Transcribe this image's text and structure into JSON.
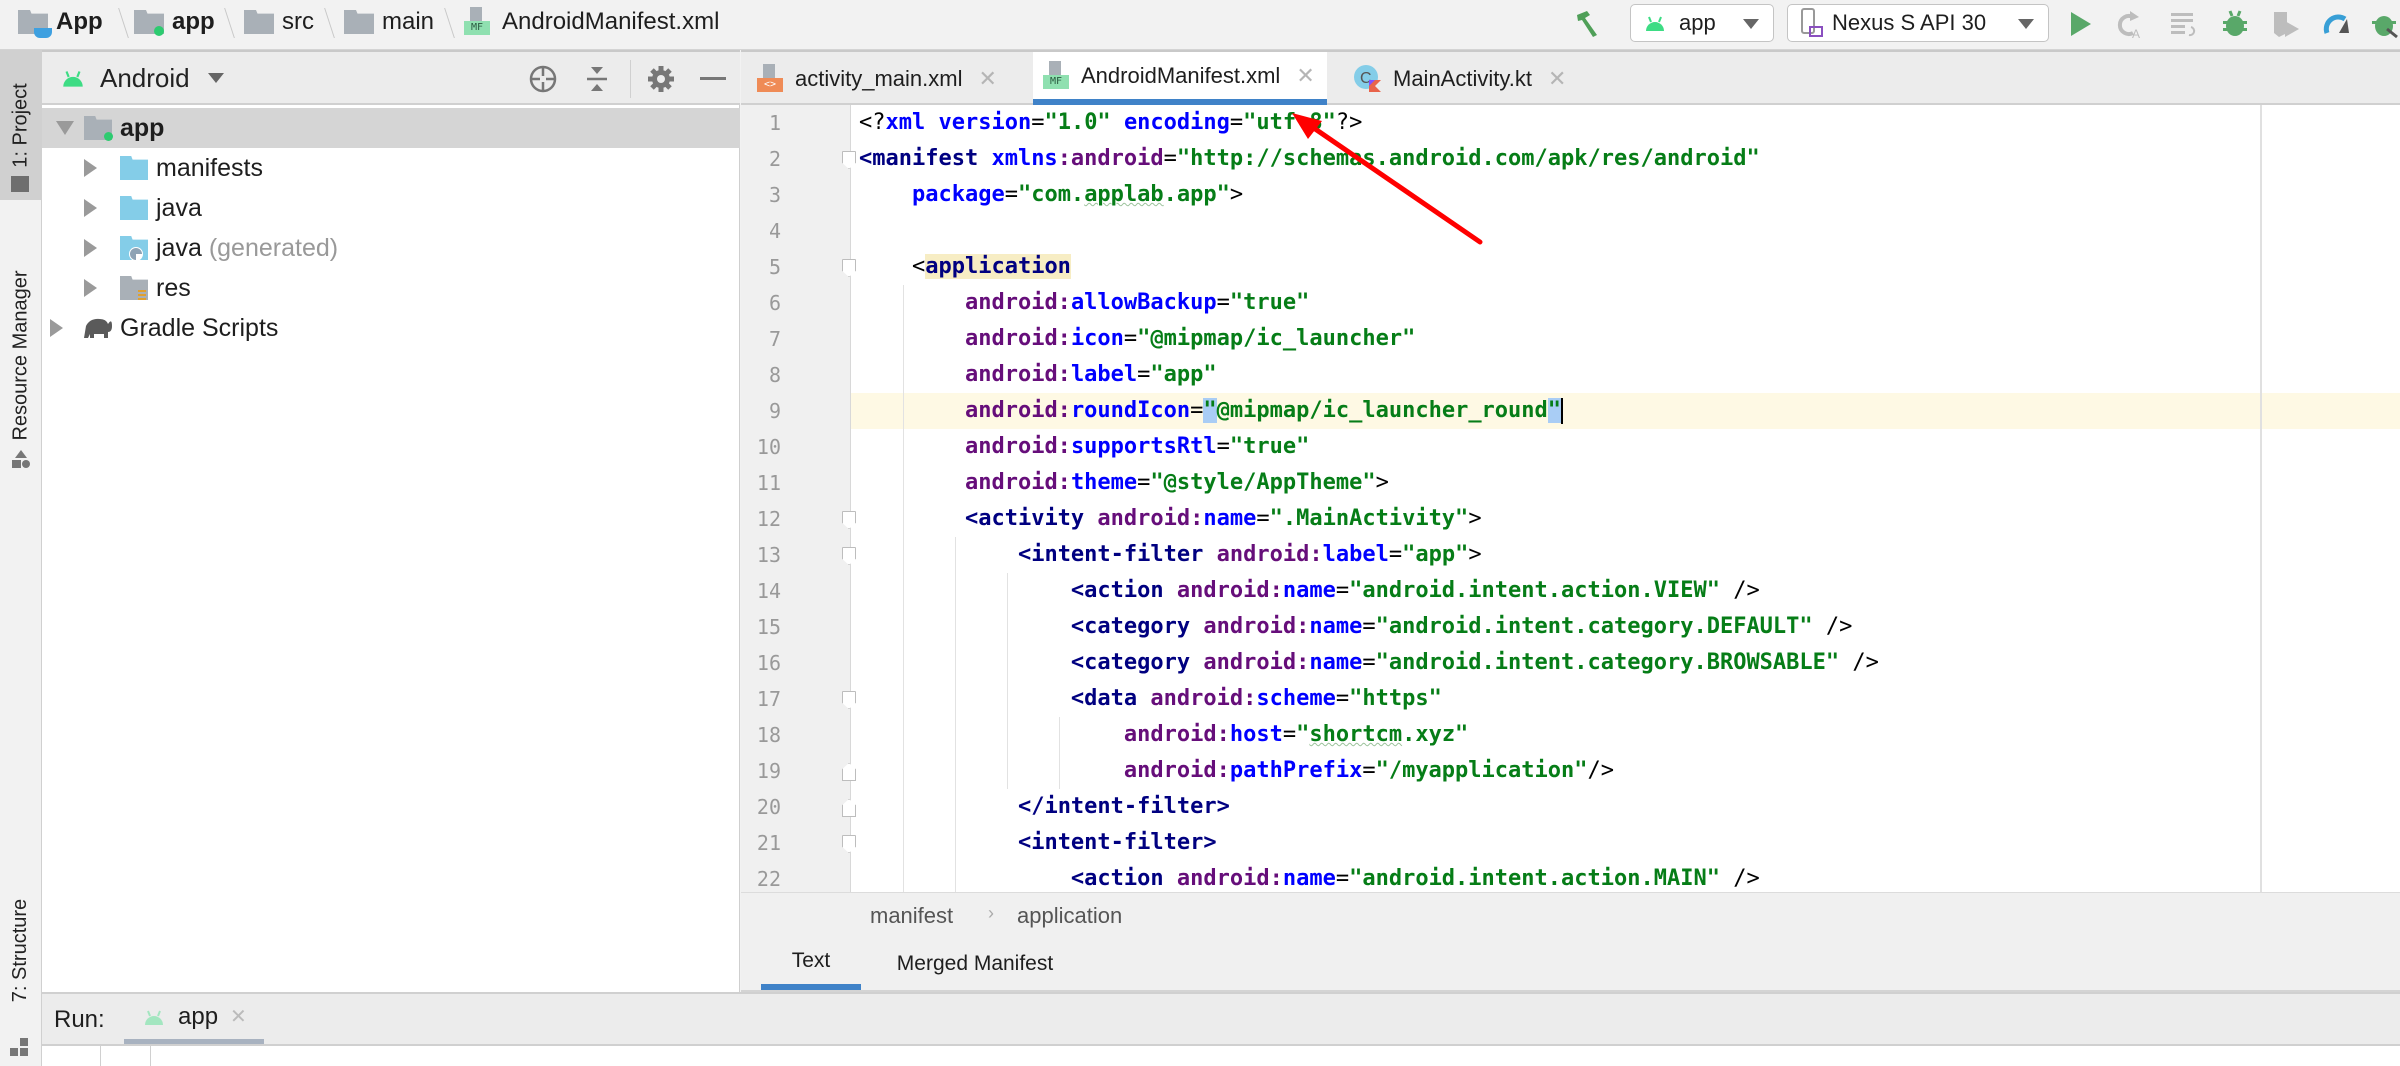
{
  "navbar": {
    "breadcrumb": [
      {
        "label": "App",
        "icon": "project-folder-icon"
      },
      {
        "label": "app",
        "icon": "module-folder-icon"
      },
      {
        "label": "src",
        "icon": "folder-icon"
      },
      {
        "label": "main",
        "icon": "folder-icon"
      },
      {
        "label": "AndroidManifest.xml",
        "icon": "manifest-file-icon"
      }
    ],
    "run_config": "app",
    "device": "Nexus S API 30",
    "toolbar_icons": [
      "build-hammer-icon",
      "run-icon",
      "apply-changes-icon",
      "apply-code-changes-icon",
      "debug-icon",
      "run-with-coverage-icon",
      "profile-icon",
      "attach-debugger-icon"
    ]
  },
  "left_stripe": {
    "tabs": [
      {
        "label": "1: Project",
        "active": true
      },
      {
        "label": "Resource Manager",
        "active": false
      },
      {
        "label": "7: Structure",
        "active": false
      }
    ]
  },
  "project_panel": {
    "view_selector": "Android",
    "header_icons": [
      "locate-icon",
      "collapse-all-icon",
      "settings-gear-icon",
      "hide-panel-icon"
    ],
    "tree": [
      {
        "label": "app",
        "level": 0,
        "expanded": true,
        "selected": true,
        "bold": true
      },
      {
        "label": "manifests",
        "level": 1,
        "expanded": false
      },
      {
        "label": "java",
        "level": 1,
        "expanded": false
      },
      {
        "label": "java",
        "suffix": "(generated)",
        "level": 1,
        "expanded": false
      },
      {
        "label": "res",
        "level": 1,
        "expanded": false
      },
      {
        "label": "Gradle Scripts",
        "level": 0,
        "expanded": false
      }
    ]
  },
  "editor_tabs": [
    {
      "label": "activity_main.xml",
      "active": false,
      "badge": "<>"
    },
    {
      "label": "AndroidManifest.xml",
      "active": true,
      "badge": "MF"
    },
    {
      "label": "MainActivity.kt",
      "active": false,
      "badge": "K"
    }
  ],
  "editor": {
    "current_line": 9,
    "lines": [
      {
        "n": "1",
        "tokens": [
          [
            "p",
            "<?"
          ],
          [
            "attr",
            "xml "
          ],
          [
            "attr",
            "version"
          ],
          [
            "p",
            "="
          ],
          [
            "val",
            "\"1.0\" "
          ],
          [
            "attr",
            "encoding"
          ],
          [
            "p",
            "="
          ],
          [
            "val",
            "\"utf-8\""
          ],
          [
            "p",
            "?>"
          ]
        ]
      },
      {
        "n": "2",
        "tokens": [
          [
            "tag",
            "<manifest "
          ],
          [
            "attr",
            "xmlns"
          ],
          [
            "ns",
            ":android"
          ],
          [
            "p",
            "="
          ],
          [
            "val",
            "\"http://schemas.android.com/apk/res/android\""
          ]
        ]
      },
      {
        "n": "3",
        "tokens": [
          [
            "ind",
            "    "
          ],
          [
            "attr",
            "package"
          ],
          [
            "p",
            "="
          ],
          [
            "val",
            "\"com.applab.app\""
          ],
          [
            "p",
            ">"
          ]
        ]
      },
      {
        "n": "4",
        "tokens": []
      },
      {
        "n": "5",
        "tokens": [
          [
            "ind",
            "    "
          ],
          [
            "p",
            "<"
          ],
          [
            "tagh",
            "application"
          ]
        ]
      },
      {
        "n": "6",
        "tokens": [
          [
            "ind",
            "        "
          ],
          [
            "ns",
            "android:"
          ],
          [
            "attr",
            "allowBackup"
          ],
          [
            "p",
            "="
          ],
          [
            "val",
            "\"true\""
          ]
        ]
      },
      {
        "n": "7",
        "tokens": [
          [
            "ind",
            "        "
          ],
          [
            "ns",
            "android:"
          ],
          [
            "attr",
            "icon"
          ],
          [
            "p",
            "="
          ],
          [
            "val",
            "\"@mipmap/ic_launcher\""
          ]
        ]
      },
      {
        "n": "8",
        "tokens": [
          [
            "ind",
            "        "
          ],
          [
            "ns",
            "android:"
          ],
          [
            "attr",
            "label"
          ],
          [
            "p",
            "="
          ],
          [
            "val",
            "\"app\""
          ]
        ]
      },
      {
        "n": "9",
        "tokens": [
          [
            "ind",
            "        "
          ],
          [
            "ns",
            "android:"
          ],
          [
            "attr",
            "roundIcon"
          ],
          [
            "p",
            "="
          ],
          [
            "valm",
            "\""
          ],
          [
            "val",
            "@mipmap/ic_launcher_round"
          ],
          [
            "valm",
            "\""
          ]
        ]
      },
      {
        "n": "10",
        "tokens": [
          [
            "ind",
            "        "
          ],
          [
            "ns",
            "android:"
          ],
          [
            "attr",
            "supportsRtl"
          ],
          [
            "p",
            "="
          ],
          [
            "val",
            "\"true\""
          ]
        ]
      },
      {
        "n": "11",
        "tokens": [
          [
            "ind",
            "        "
          ],
          [
            "ns",
            "android:"
          ],
          [
            "attr",
            "theme"
          ],
          [
            "p",
            "="
          ],
          [
            "val",
            "\"@style/AppTheme\""
          ],
          [
            "p",
            ">"
          ]
        ]
      },
      {
        "n": "12",
        "tokens": [
          [
            "ind",
            "        "
          ],
          [
            "tag",
            "<activity "
          ],
          [
            "ns",
            "android:"
          ],
          [
            "attr",
            "name"
          ],
          [
            "p",
            "="
          ],
          [
            "val",
            "\".MainActivity\""
          ],
          [
            "p",
            ">"
          ]
        ]
      },
      {
        "n": "13",
        "tokens": [
          [
            "ind",
            "            "
          ],
          [
            "tag",
            "<intent-filter "
          ],
          [
            "ns",
            "android:"
          ],
          [
            "attr",
            "label"
          ],
          [
            "p",
            "="
          ],
          [
            "val",
            "\"app\""
          ],
          [
            "p",
            ">"
          ]
        ]
      },
      {
        "n": "14",
        "tokens": [
          [
            "ind",
            "                "
          ],
          [
            "tag",
            "<action "
          ],
          [
            "ns",
            "android:"
          ],
          [
            "attr",
            "name"
          ],
          [
            "p",
            "="
          ],
          [
            "val",
            "\"android.intent.action.VIEW\" "
          ],
          [
            "p",
            "/>"
          ]
        ]
      },
      {
        "n": "15",
        "tokens": [
          [
            "ind",
            "                "
          ],
          [
            "tag",
            "<category "
          ],
          [
            "ns",
            "android:"
          ],
          [
            "attr",
            "name"
          ],
          [
            "p",
            "="
          ],
          [
            "val",
            "\"android.intent.category.DEFAULT\" "
          ],
          [
            "p",
            "/>"
          ]
        ]
      },
      {
        "n": "16",
        "tokens": [
          [
            "ind",
            "                "
          ],
          [
            "tag",
            "<category "
          ],
          [
            "ns",
            "android:"
          ],
          [
            "attr",
            "name"
          ],
          [
            "p",
            "="
          ],
          [
            "val",
            "\"android.intent.category.BROWSABLE\" "
          ],
          [
            "p",
            "/>"
          ]
        ]
      },
      {
        "n": "17",
        "tokens": [
          [
            "ind",
            "                "
          ],
          [
            "tag",
            "<data "
          ],
          [
            "ns",
            "android:"
          ],
          [
            "attr",
            "scheme"
          ],
          [
            "p",
            "="
          ],
          [
            "val",
            "\"https\""
          ]
        ]
      },
      {
        "n": "18",
        "tokens": [
          [
            "ind",
            "                    "
          ],
          [
            "ns",
            "android:"
          ],
          [
            "attr",
            "host"
          ],
          [
            "p",
            "="
          ],
          [
            "val",
            "\""
          ],
          [
            "valsq",
            "shortcm"
          ],
          [
            "val",
            ".xyz\""
          ]
        ]
      },
      {
        "n": "19",
        "tokens": [
          [
            "ind",
            "                    "
          ],
          [
            "ns",
            "android:"
          ],
          [
            "attr",
            "pathPrefix"
          ],
          [
            "p",
            "="
          ],
          [
            "val",
            "\"/myapplication\""
          ],
          [
            "p",
            "/>"
          ]
        ]
      },
      {
        "n": "20",
        "tokens": [
          [
            "ind",
            "            "
          ],
          [
            "tag",
            "</intent-filter>"
          ]
        ]
      },
      {
        "n": "21",
        "tokens": [
          [
            "ind",
            "            "
          ],
          [
            "tag",
            "<intent-filter>"
          ]
        ]
      },
      {
        "n": "22",
        "tokens": [
          [
            "ind",
            "                "
          ],
          [
            "tag",
            "<action "
          ],
          [
            "ns",
            "android:"
          ],
          [
            "attr",
            "name"
          ],
          [
            "p",
            "="
          ],
          [
            "val",
            "\"android.intent.action.MAIN\" "
          ],
          [
            "p",
            "/>"
          ]
        ]
      }
    ]
  },
  "xml_breadcrumb": [
    "manifest",
    "application"
  ],
  "bottom_tabs": [
    {
      "label": "Text",
      "active": true
    },
    {
      "label": "Merged Manifest",
      "active": false
    }
  ],
  "run_panel": {
    "label": "Run:",
    "tab": "app"
  },
  "annotation": {
    "type": "red-arrow",
    "color": "#ff0000",
    "points_to": "AndroidManifest.xml tab"
  },
  "colors": {
    "accent": "#3f82c8",
    "android_green": "#3ddc84",
    "arrow": "#ff0000"
  }
}
